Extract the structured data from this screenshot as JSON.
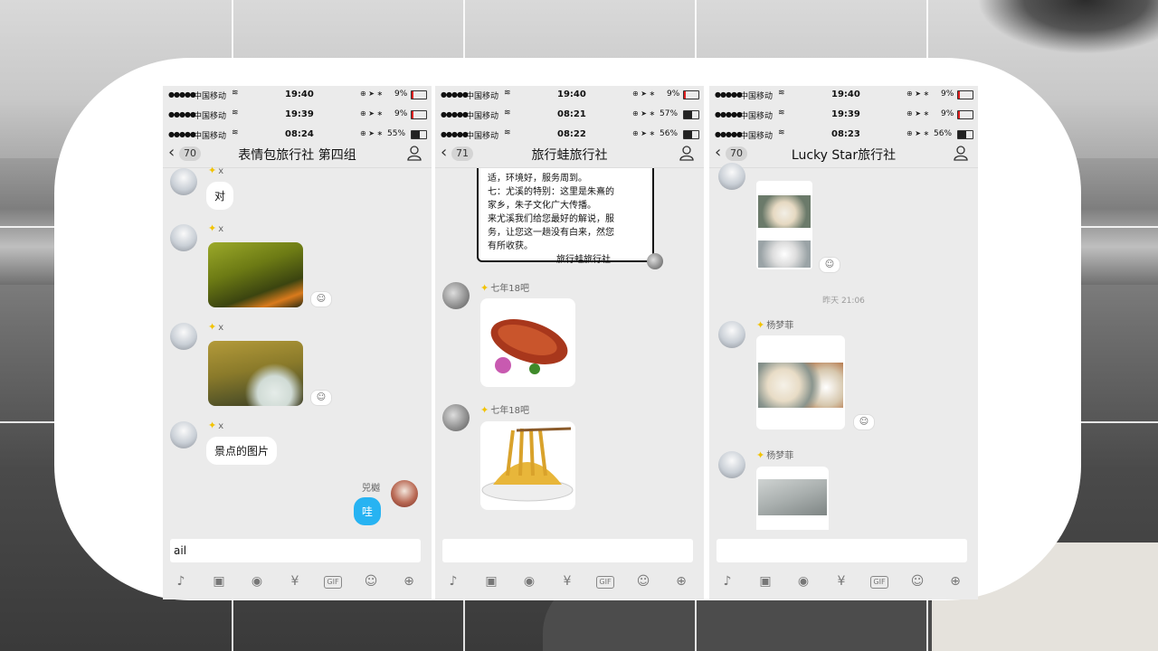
{
  "background": {
    "accent": "#ffffff"
  },
  "phones": [
    {
      "status_bars": [
        {
          "carrier": "中国移动",
          "time": "19:40",
          "battery": "9%",
          "level": 0.09
        },
        {
          "carrier": "中国移动",
          "time": "19:39",
          "battery": "9%",
          "level": 0.09
        },
        {
          "carrier": "中国移动",
          "time": "08:24",
          "battery": "55%",
          "level": 0.55
        }
      ],
      "nav": {
        "back_count": "70",
        "title": "表情包旅行社  第四组"
      },
      "messages": [
        {
          "sender": "x",
          "text": "对"
        },
        {
          "sender": "x",
          "image": "autumn-tree-photo"
        },
        {
          "sender": "x",
          "image": "yellow-tree-photo"
        },
        {
          "sender": "x",
          "text": "景点的图片"
        },
        {
          "sender": "兕樾",
          "text": "哇",
          "mine": true
        }
      ],
      "input_value": "ail"
    },
    {
      "status_bars": [
        {
          "carrier": "中国移动",
          "time": "19:40",
          "battery": "9%",
          "level": 0.09
        },
        {
          "carrier": "中国移动",
          "time": "08:21",
          "battery": "57%",
          "level": 0.57
        },
        {
          "carrier": "中国移动",
          "time": "08:22",
          "battery": "56%",
          "level": 0.56
        }
      ],
      "nav": {
        "back_count": "71",
        "title": "旅行蛙旅行社"
      },
      "letter": {
        "lines": [
          "适，环境好，服务周到。",
          "七：尤溪的特别：这里是朱熹的",
          "家乡，朱子文化广大传播。",
          "来尤溪我们给您最好的解说，服",
          "务，让您这一趟没有白来，然您",
          "有所收获。"
        ],
        "signature": "旅行蛙旅行社"
      },
      "messages": [
        {
          "sender": "七年18吧",
          "image": "roast-duck-photo"
        },
        {
          "sender": "七年18吧",
          "image": "noodles-photo"
        }
      ],
      "input_value": ""
    },
    {
      "status_bars": [
        {
          "carrier": "中国移动",
          "time": "19:40",
          "battery": "9%",
          "level": 0.09
        },
        {
          "carrier": "中国移动",
          "time": "19:39",
          "battery": "9%",
          "level": 0.09
        },
        {
          "carrier": "中国移动",
          "time": "08:23",
          "battery": "56%",
          "level": 0.56
        }
      ],
      "nav": {
        "back_count": "70",
        "title": "Lucky Star旅行社"
      },
      "timestamp": "昨天 21:06",
      "messages": [
        {
          "sender": "杨梦菲",
          "image": "dumpling-card-1"
        },
        {
          "sender": "杨梦菲",
          "image": "dumpling-card-2"
        },
        {
          "sender": "杨梦菲",
          "image": "noodle-card"
        }
      ],
      "input_value": ""
    }
  ],
  "toolbar_icons": [
    "microphone-icon",
    "image-icon",
    "camera-icon",
    "red-packet-icon",
    "gif-icon",
    "emoji-icon",
    "plus-icon"
  ],
  "toolbar_gif_label": "GIF"
}
